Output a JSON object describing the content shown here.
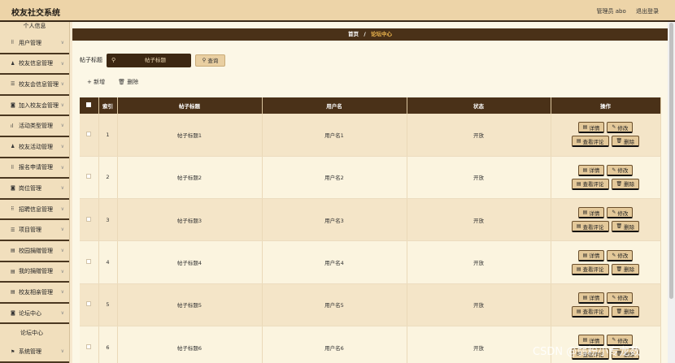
{
  "app": {
    "title": "校友社交系统"
  },
  "header": {
    "user": "管理员 abo",
    "logout": "退出登录"
  },
  "sidebar": {
    "top": "个人信息",
    "items": [
      {
        "icon": "grid-icon",
        "glyph": "⠿",
        "label": "用户管理"
      },
      {
        "icon": "person-icon",
        "glyph": "♟",
        "label": "校友信息管理"
      },
      {
        "icon": "list-icon",
        "glyph": "☰",
        "label": "校友会信息管理"
      },
      {
        "icon": "join-icon",
        "glyph": "◙",
        "label": "加入校友会管理"
      },
      {
        "icon": "bar-chart-icon",
        "glyph": "ıl",
        "label": "活动类型管理"
      },
      {
        "icon": "person-icon",
        "glyph": "♟",
        "label": "校友活动管理"
      },
      {
        "icon": "grid-icon",
        "glyph": "⠿",
        "label": "报名申请管理"
      },
      {
        "icon": "briefcase-icon",
        "glyph": "◙",
        "label": "岗位管理"
      },
      {
        "icon": "grid-icon",
        "glyph": "⠿",
        "label": "招聘信息管理"
      },
      {
        "icon": "list-icon",
        "glyph": "☰",
        "label": "项目管理"
      },
      {
        "icon": "doc-icon",
        "glyph": "▤",
        "label": "校园捐赠管理"
      },
      {
        "icon": "doc-icon",
        "glyph": "▤",
        "label": "我的捐赠管理"
      },
      {
        "icon": "doc-icon",
        "glyph": "▤",
        "label": "校友相亲管理"
      },
      {
        "icon": "forum-icon",
        "glyph": "◙",
        "label": "论坛中心"
      }
    ],
    "sub": "论坛中心",
    "last": {
      "icon": "flag-icon",
      "glyph": "⚑",
      "label": "系统管理"
    }
  },
  "breadcrumb": {
    "home": "首页",
    "sep": "/",
    "current": "论坛中心"
  },
  "search": {
    "label": "帖子标题",
    "placeholder": "帖子标题",
    "button": "查询"
  },
  "actions": {
    "add": "新增",
    "delete": "删除"
  },
  "table": {
    "headers": {
      "index": "索引",
      "title": "帖子标题",
      "user": "用户名",
      "status": "状态",
      "ops": "操作"
    },
    "rows": [
      {
        "index": "1",
        "title": "帖子标题1",
        "user": "用户名1",
        "status": "开放"
      },
      {
        "index": "2",
        "title": "帖子标题2",
        "user": "用户名2",
        "status": "开放"
      },
      {
        "index": "3",
        "title": "帖子标题3",
        "user": "用户名3",
        "status": "开放"
      },
      {
        "index": "4",
        "title": "帖子标题4",
        "user": "用户名4",
        "status": "开放"
      },
      {
        "index": "5",
        "title": "帖子标题5",
        "user": "用户名5",
        "status": "开放"
      },
      {
        "index": "6",
        "title": "帖子标题6",
        "user": "用户名6",
        "status": "开放"
      }
    ],
    "ops": {
      "detail": "详情",
      "edit": "修改",
      "comments": "查看评论",
      "delete": "删除"
    }
  },
  "watermark": "CSDN @弱粉小专龙数"
}
